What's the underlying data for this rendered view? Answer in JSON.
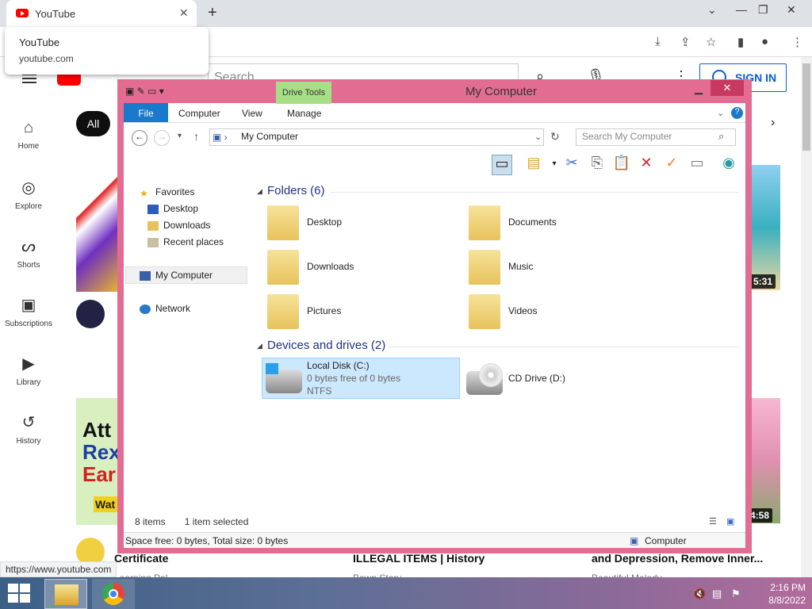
{
  "browser": {
    "tab_title": "YouTube",
    "tooltip_title": "YouTube",
    "tooltip_url": "youtube.com",
    "status_url": "https://www.youtube.com"
  },
  "youtube": {
    "search_placeholder": "Search",
    "signin_label": "SIGN IN",
    "chip_all": "All",
    "nav": [
      {
        "label": "Home",
        "icon": "home-icon"
      },
      {
        "label": "Explore",
        "icon": "compass-icon"
      },
      {
        "label": "Shorts",
        "icon": "shorts-icon"
      },
      {
        "label": "Subscriptions",
        "icon": "subscriptions-icon"
      },
      {
        "label": "Library",
        "icon": "library-icon"
      },
      {
        "label": "History",
        "icon": "history-icon"
      }
    ],
    "durations": [
      "5:31",
      "4:58"
    ],
    "bottom_titles": [
      "Certificate",
      "ILLEGAL ITEMS | History",
      "and Depression, Remove Inner..."
    ],
    "bottom_sub": [
      "Learning Pal",
      "Bown Story",
      "Beautiful Melody"
    ],
    "thumb_text": [
      "Att",
      "Rex",
      "Ear",
      "Wat"
    ]
  },
  "explorer": {
    "title": "My Computer",
    "drive_tools": "Drive Tools",
    "tabs": [
      "File",
      "Computer",
      "View",
      "Manage"
    ],
    "address": "My Computer",
    "search_placeholder": "Search My Computer",
    "nav": {
      "favorites": "Favorites",
      "desktop": "Desktop",
      "downloads": "Downloads",
      "recent": "Recent places",
      "mycomputer": "My Computer",
      "network": "Network"
    },
    "folders_header": "Folders (6)",
    "folders": [
      "Desktop",
      "Documents",
      "Downloads",
      "Music",
      "Pictures",
      "Videos"
    ],
    "drives_header": "Devices and drives (2)",
    "drive_c": {
      "name": "Local Disk (C:)",
      "space": "0 bytes free of 0 bytes",
      "fs": "NTFS"
    },
    "drive_d": {
      "name": "CD Drive (D:)"
    },
    "status_items": "8 items",
    "status_selected": "1 item selected",
    "status_space": "Space free: 0 bytes, Total size: 0 bytes",
    "status_location": "Computer"
  },
  "taskbar": {
    "time": "2:16 PM",
    "date": "8/8/2022"
  }
}
